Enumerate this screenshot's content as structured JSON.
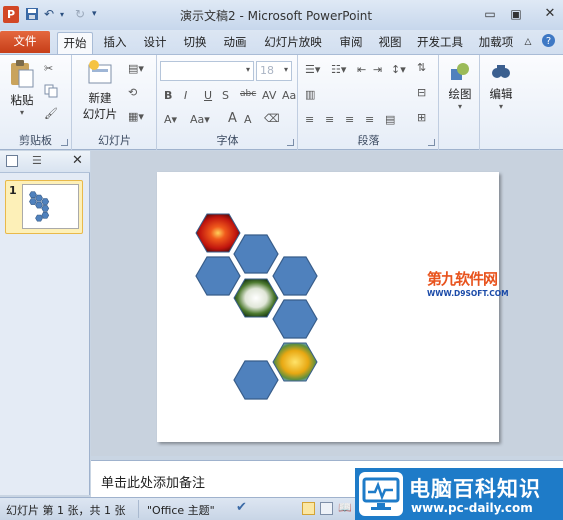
{
  "window": {
    "title": "演示文稿2 - Microsoft PowerPoint",
    "app_icon": "P",
    "quick_access": [
      "save-icon",
      "undo-icon",
      "redo-icon",
      "customize-icon"
    ]
  },
  "tabs": [
    {
      "label": "文件",
      "kind": "file"
    },
    {
      "label": "开始",
      "active": true
    },
    {
      "label": "插入"
    },
    {
      "label": "设计"
    },
    {
      "label": "切换"
    },
    {
      "label": "动画"
    },
    {
      "label": "幻灯片放映"
    },
    {
      "label": "审阅"
    },
    {
      "label": "视图"
    },
    {
      "label": "开发工具"
    },
    {
      "label": "加载项"
    }
  ],
  "ribbon": {
    "clipboard": {
      "label": "剪贴板",
      "paste": "粘贴"
    },
    "slides": {
      "label": "幻灯片",
      "new_slide_line1": "新建",
      "new_slide_line2": "幻灯片"
    },
    "font": {
      "label": "字体",
      "size": "18"
    },
    "paragraph": {
      "label": "段落"
    },
    "drawing": {
      "label": "绘图"
    },
    "editing": {
      "label": "编辑"
    }
  },
  "slide_panel": {
    "slide_number": "1"
  },
  "notes": {
    "placeholder": "单击此处添加备注"
  },
  "status": {
    "slide_info": "幻灯片 第 1 张，共 1 张",
    "theme": "\"Office 主题\""
  },
  "watermarks": {
    "slide_logo_cn": "第九软件网",
    "slide_logo_url": "WWW.D9SOFT.COM",
    "corner_cn": "电脑百科知识",
    "corner_url": "www.pc-daily.com"
  },
  "colors": {
    "hexagon_fill": "#4f81bd",
    "hexagon_stroke": "#385d8a",
    "file_tab": "#d24726",
    "accent": "#1e7bc8"
  }
}
